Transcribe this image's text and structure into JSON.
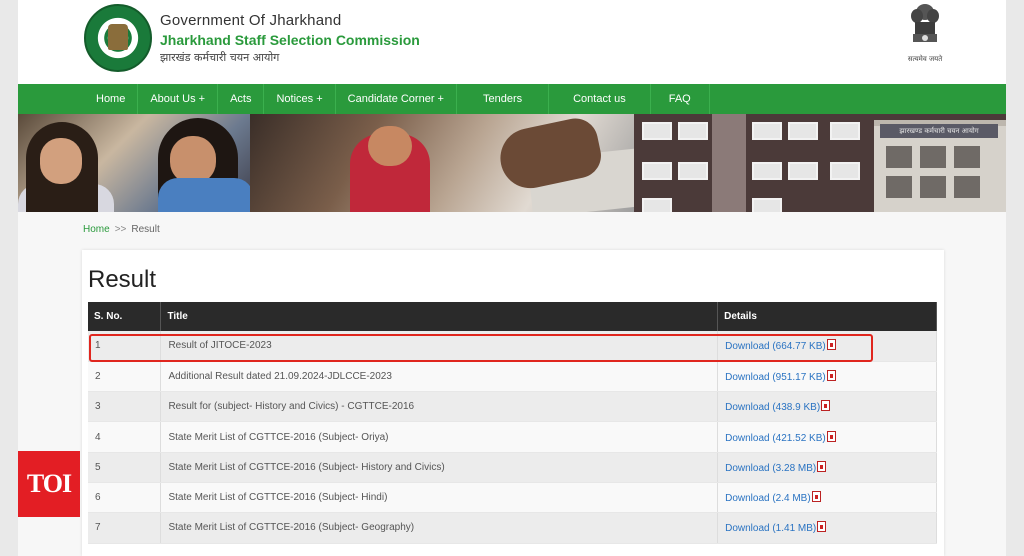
{
  "header": {
    "org_line1": "Government Of Jharkhand",
    "org_line2": "Jharkhand Staff Selection Commission",
    "org_line3": "झारखंड कर्मचारी चयन आयोग",
    "emblem_text": "सत्यमेव जयते"
  },
  "nav": {
    "items": [
      "Home",
      "About Us +",
      "Acts",
      "Notices +",
      "Candidate Corner +",
      "Tenders",
      "Contact us",
      "FAQ"
    ]
  },
  "banner": {
    "building_sign": "झारखण्ड कर्मचारी चयन आयोग"
  },
  "breadcrumb": {
    "home": "Home",
    "separator": ">>",
    "current": "Result"
  },
  "result": {
    "title": "Result",
    "columns": [
      "S. No.",
      "Title",
      "Details"
    ],
    "rows": [
      {
        "sno": "1",
        "title": "Result of JITOCE-2023",
        "details": "Download (664.77 KB)"
      },
      {
        "sno": "2",
        "title": "Additional Result dated 21.09.2024-JDLCCE-2023",
        "details": "Download (951.17 KB)"
      },
      {
        "sno": "3",
        "title": "Result for (subject- History and Civics) - CGTTCE-2016",
        "details": "Download (438.9 KB)"
      },
      {
        "sno": "4",
        "title": "State Merit List of CGTTCE-2016 (Subject- Oriya)",
        "details": "Download (421.52 KB)"
      },
      {
        "sno": "5",
        "title": "State Merit List of CGTTCE-2016 (Subject- History and Civics)",
        "details": "Download (3.28 MB)"
      },
      {
        "sno": "6",
        "title": "State Merit List of CGTTCE-2016 (Subject- Hindi)",
        "details": "Download (2.4 MB)"
      },
      {
        "sno": "7",
        "title": "State Merit List of CGTTCE-2016 (Subject- Geography)",
        "details": "Download (1.41 MB)"
      }
    ]
  },
  "watermark": {
    "text": "TOI"
  },
  "colors": {
    "nav_green": "#2a9a3c",
    "header_dark": "#2a2a2a",
    "link_blue": "#2a73c2",
    "highlight_red": "#e0261e",
    "toi_red": "#e31e24"
  },
  "icons": {
    "pdf": "pdf-file-icon"
  }
}
